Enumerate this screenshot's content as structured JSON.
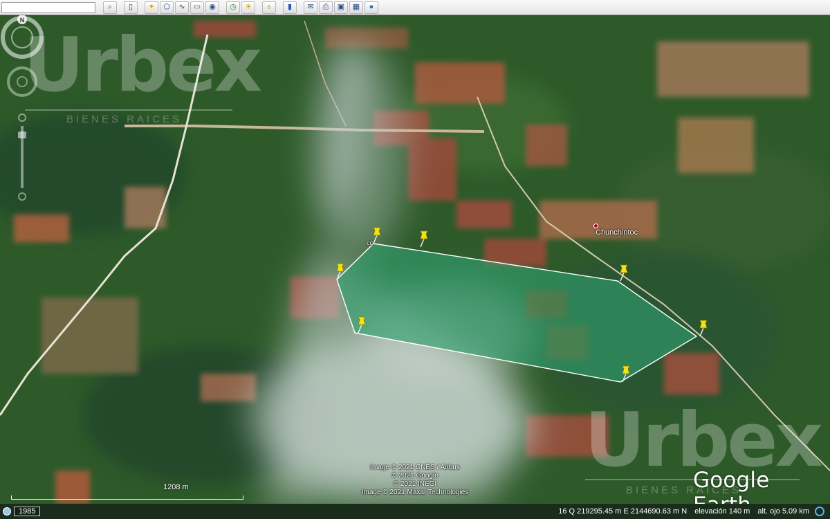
{
  "toolbar": {
    "search_value": "",
    "buttons": [
      {
        "name": "search-icon",
        "glyph": "🔍"
      },
      {
        "name": "sidebar-toggle-icon",
        "glyph": "▯"
      },
      {
        "name": "add-placemark-icon",
        "glyph": "☆"
      },
      {
        "name": "add-polygon-icon",
        "glyph": "⬠"
      },
      {
        "name": "add-path-icon",
        "glyph": "∿"
      },
      {
        "name": "image-overlay-icon",
        "glyph": "▭"
      },
      {
        "name": "record-tour-icon",
        "glyph": "◉"
      },
      {
        "name": "historical-imagery-icon",
        "glyph": "◷"
      },
      {
        "name": "sunlight-icon",
        "glyph": "☀"
      },
      {
        "name": "planets-icon",
        "glyph": "♁"
      },
      {
        "name": "ruler-icon",
        "glyph": "▮"
      },
      {
        "name": "email-icon",
        "glyph": "✉"
      },
      {
        "name": "print-icon",
        "glyph": "⎙"
      },
      {
        "name": "save-image-icon",
        "glyph": "▣"
      },
      {
        "name": "view-in-maps-icon",
        "glyph": "▦"
      },
      {
        "name": "earth-gallery-icon",
        "glyph": "●"
      }
    ]
  },
  "map": {
    "place_label": "Chunchintoc",
    "placemark_label": "cc",
    "credits": [
      "Image © 2021 CNES / Airbus",
      "© 2021 Google",
      "© 2021 INEGI",
      "Image © 2021 Maxar Technologies"
    ],
    "scale_label": "1208 m",
    "logo": "Google Earth",
    "compass_letter": "N",
    "watermark_word": "Urbex",
    "watermark_sub": "BIENES RAICES"
  },
  "status": {
    "year": "1985",
    "coords": "16 Q 219295.45 m E 2144690.63 m N",
    "elevation": "elevación  140 m",
    "eye_alt": "alt. ojo  5.09 km"
  },
  "colors": {
    "forest": "#2f5a2a",
    "cleared_red": "#a8553c",
    "polygon_fill": "#2f9e6a",
    "pin_yellow": "#f2e21a"
  }
}
